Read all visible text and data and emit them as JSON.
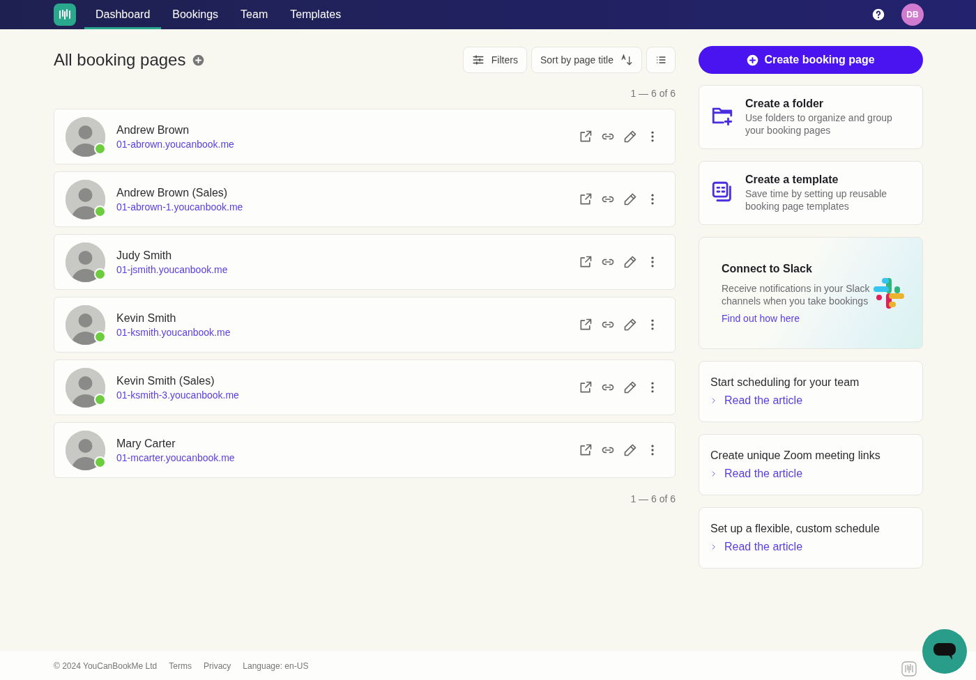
{
  "nav": {
    "tabs": [
      {
        "label": "Dashboard",
        "selected": true
      },
      {
        "label": "Bookings",
        "selected": false
      },
      {
        "label": "Team",
        "selected": false
      },
      {
        "label": "Templates",
        "selected": false
      }
    ],
    "avatar_initials": "DB"
  },
  "heading": {
    "title": "All booking pages"
  },
  "toolbar": {
    "filters": "Filters",
    "sort": "Sort by page title"
  },
  "pagination_top": "1 — 6 of 6",
  "booking_pages": [
    {
      "name": "Andrew Brown",
      "url": "01-abrown.youcanbook.me",
      "online": true
    },
    {
      "name": "Andrew Brown (Sales)",
      "url": "01-abrown-1.youcanbook.me",
      "online": true
    },
    {
      "name": "Judy Smith",
      "url": "01-jsmith.youcanbook.me",
      "online": true
    },
    {
      "name": "Kevin Smith",
      "url": "01-ksmith.youcanbook.me",
      "online": true
    },
    {
      "name": "Kevin Smith (Sales)",
      "url": "01-ksmith-3.youcanbook.me",
      "online": true
    },
    {
      "name": "Mary Carter",
      "url": "01-mcarter.youcanbook.me",
      "online": true
    }
  ],
  "pagination_bottom": "1 — 6 of 6",
  "create_button": "Create booking page",
  "action_cards": [
    {
      "kind": "folder",
      "title": "Create a folder",
      "description": "Use folders to organize and group your booking pages"
    },
    {
      "kind": "template",
      "title": "Create a template",
      "description": "Save time by setting up reusable booking page templates"
    }
  ],
  "slack_card": {
    "title": "Connect to Slack",
    "description": "Receive notifications in your Slack channels when you take bookings",
    "link": "Find out how here"
  },
  "article_cards": [
    {
      "title": "Start scheduling for your team",
      "link": "Read the article"
    },
    {
      "title": "Create unique Zoom meeting links",
      "link": "Read the article"
    },
    {
      "title": "Set up a flexible, custom schedule",
      "link": "Read the article"
    }
  ],
  "footer": {
    "copyright": "© 2024 YouCanBookMe Ltd",
    "links": [
      "Terms",
      "Privacy",
      "Language: en-US"
    ]
  }
}
